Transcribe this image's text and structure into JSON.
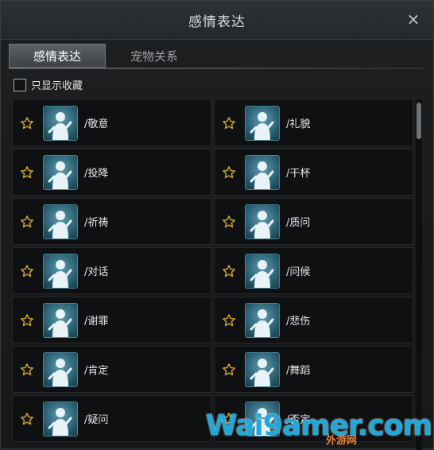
{
  "window": {
    "title": "感情表达",
    "close_label": "×"
  },
  "tabs": [
    {
      "label": "感情表达",
      "active": true
    },
    {
      "label": "宠物关系",
      "active": false
    }
  ],
  "filter": {
    "label": "只显示收藏",
    "checked": false
  },
  "emotes": [
    {
      "name": "/敬意",
      "icon": "bowing-figure-icon"
    },
    {
      "name": "/礼貌",
      "icon": "polite-figure-icon"
    },
    {
      "name": "/投降",
      "icon": "surrender-figure-icon"
    },
    {
      "name": "/干杯",
      "icon": "cheers-figure-icon"
    },
    {
      "name": "/祈祷",
      "icon": "praying-figure-icon"
    },
    {
      "name": "/质问",
      "icon": "questioning-figure-icon"
    },
    {
      "name": "/对话",
      "icon": "talking-figure-icon"
    },
    {
      "name": "/问候",
      "icon": "greeting-figure-icon"
    },
    {
      "name": "/谢罪",
      "icon": "apology-figure-icon"
    },
    {
      "name": "/悲伤",
      "icon": "sad-figure-icon"
    },
    {
      "name": "/肯定",
      "icon": "affirm-figure-icon"
    },
    {
      "name": "/舞蹈",
      "icon": "dancing-figure-icon"
    },
    {
      "name": "/疑问",
      "icon": "doubt-figure-icon"
    },
    {
      "name": "/否定",
      "icon": "deny-figure-icon"
    }
  ],
  "watermark": {
    "text": "Wai9amer.com",
    "sub": "外游网"
  },
  "colors": {
    "star": "#c9a227",
    "accent": "#20a8d8",
    "portrait": "#3f7f93"
  }
}
